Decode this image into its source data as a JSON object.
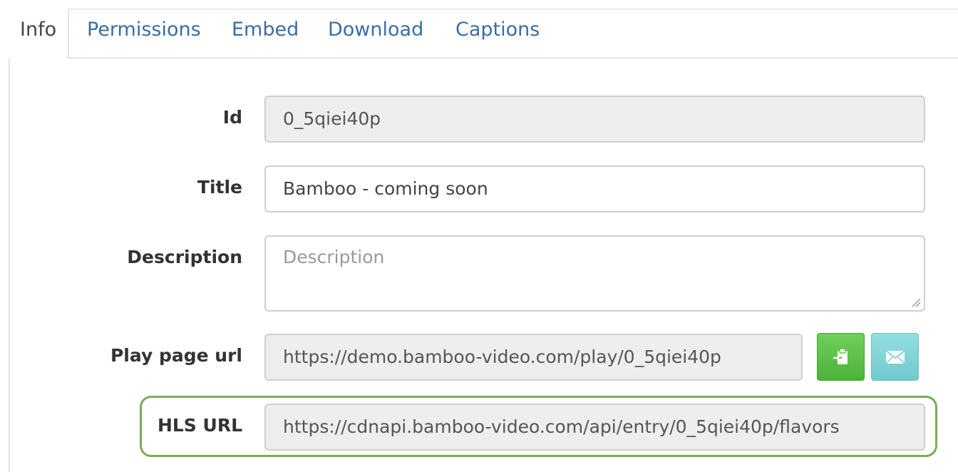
{
  "tabs": [
    {
      "label": "Info",
      "active": true
    },
    {
      "label": "Permissions",
      "active": false
    },
    {
      "label": "Embed",
      "active": false
    },
    {
      "label": "Download",
      "active": false
    },
    {
      "label": "Captions",
      "active": false
    }
  ],
  "form": {
    "id": {
      "label": "Id",
      "value": "0_5qiei40p"
    },
    "title": {
      "label": "Title",
      "value": "Bamboo - coming soon"
    },
    "description": {
      "label": "Description",
      "value": "",
      "placeholder": "Description"
    },
    "play_page_url": {
      "label": "Play page url",
      "value": "https://demo.bamboo-video.com/play/0_5qiei40p"
    },
    "hls_url": {
      "label": "HLS URL",
      "value": "https://cdnapi.bamboo-video.com/api/entry/0_5qiei40p/flavors"
    }
  },
  "buttons": {
    "copy": {
      "icon": "clipboard-icon",
      "color": "#5cbf47"
    },
    "email": {
      "icon": "envelope-icon",
      "color": "#82d4d6"
    }
  },
  "colors": {
    "link": "#3a6ea5",
    "highlight_border": "#7cab59"
  }
}
